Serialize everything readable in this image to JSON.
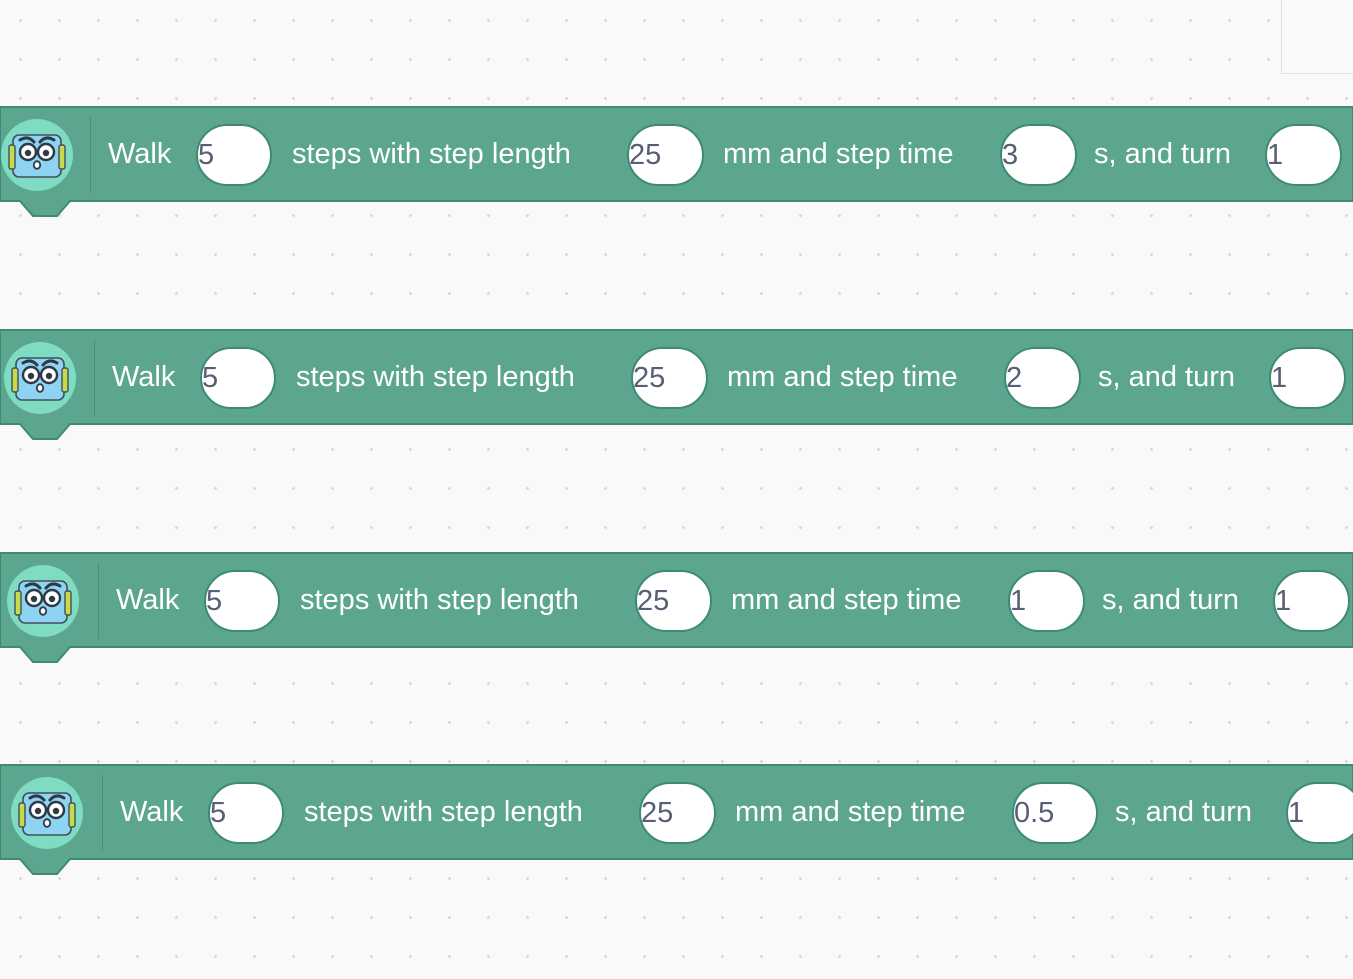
{
  "colors": {
    "block_fill": "#5ca690",
    "block_border": "#3e8a73",
    "workspace_bg": "#f9f9f9",
    "grid_dot": "#d9d9d9"
  },
  "icons": {
    "block_icon": "robot-face-icon"
  },
  "blocks": [
    {
      "label_walk": "Walk",
      "steps": "5",
      "label_steps": "steps with step length",
      "step_length": "25",
      "label_mm": "mm and step time",
      "step_time": "3",
      "label_turn": "s, and turn",
      "turn": "1"
    },
    {
      "label_walk": "Walk",
      "steps": "5",
      "label_steps": "steps with step length",
      "step_length": "25",
      "label_mm": "mm and step time",
      "step_time": "2",
      "label_turn": "s, and turn",
      "turn": "1"
    },
    {
      "label_walk": "Walk",
      "steps": "5",
      "label_steps": "steps with step length",
      "step_length": "25",
      "label_mm": "mm and step time",
      "step_time": "1",
      "label_turn": "s, and turn",
      "turn": "1"
    },
    {
      "label_walk": "Walk",
      "steps": "5",
      "label_steps": "steps with step length",
      "step_length": "25",
      "label_mm": "mm and step time",
      "step_time": "0.5",
      "label_turn": "s, and turn",
      "turn": "1"
    }
  ]
}
